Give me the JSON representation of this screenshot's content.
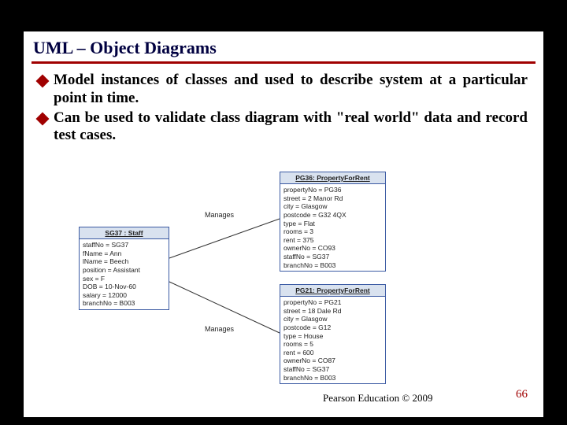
{
  "title": "UML – Object Diagrams",
  "bullets": [
    "Model instances of classes and used to describe system at a particular point in time.",
    "Can be used to validate class diagram with \"real world\" data and record test cases."
  ],
  "staff": {
    "header": "SG37 : Staff",
    "rows": [
      "staffNo = SG37",
      "fName = Ann",
      "lName = Beech",
      "position = Assistant",
      "sex = F",
      "DOB = 10-Nov-60",
      "salary = 12000",
      "branchNo = B003"
    ]
  },
  "pg36": {
    "header": "PG36: PropertyForRent",
    "rows": [
      "propertyNo = PG36",
      "street = 2 Manor Rd",
      "city = Glasgow",
      "postcode = G32 4QX",
      "type = Flat",
      "rooms = 3",
      "rent = 375",
      "ownerNo = CO93",
      "staffNo = SG37",
      "branchNo = B003"
    ]
  },
  "pg21": {
    "header": "PG21: PropertyForRent",
    "rows": [
      "propertyNo = PG21",
      "street = 18 Dale Rd",
      "city = Glasgow",
      "postcode = G12",
      "type = House",
      "rooms = 5",
      "rent = 600",
      "ownerNo = CO87",
      "staffNo = SG37",
      "branchNo = B003"
    ]
  },
  "link_label": "Manages",
  "copyright": "Pearson Education © 2009",
  "page": "66"
}
